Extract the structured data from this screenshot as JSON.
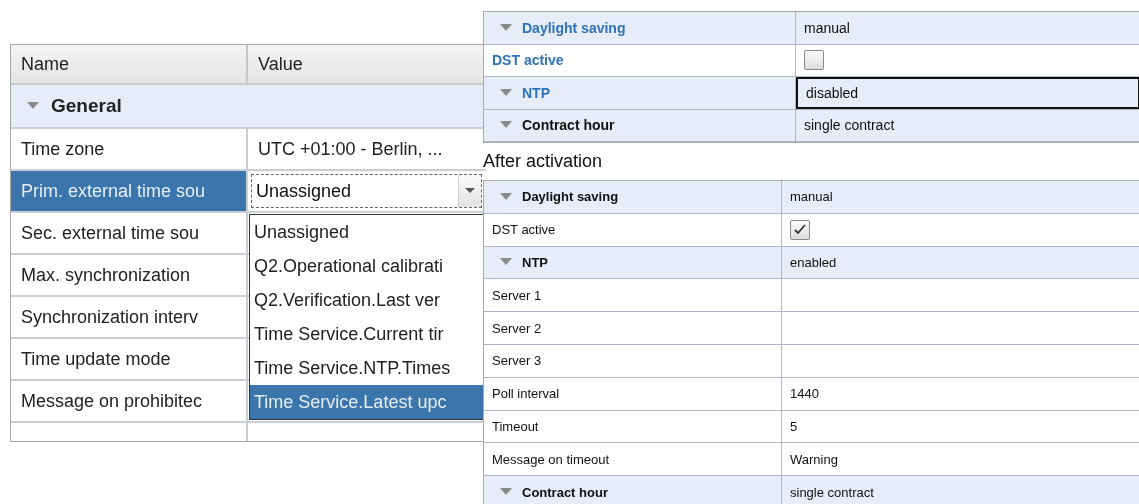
{
  "settings_table": {
    "columns": [
      "Name",
      "Value"
    ],
    "rows": [
      {
        "kind": "group",
        "name": "General",
        "expanded": true
      },
      {
        "kind": "field",
        "name": "Time zone",
        "value": "UTC +01:00 - Berlin, ...",
        "selected": false
      },
      {
        "kind": "combo",
        "name": "Prim. external time sou",
        "value": "Unassigned",
        "selected": true
      },
      {
        "kind": "field",
        "name": "Sec. external time sou",
        "selected": false
      },
      {
        "kind": "field",
        "name": "Max. synchronization",
        "selected": false
      },
      {
        "kind": "field",
        "name": "Synchronization interv",
        "selected": false
      },
      {
        "kind": "field",
        "name": "Time update mode",
        "selected": false
      },
      {
        "kind": "field",
        "name": "Message on prohibitec",
        "selected": false
      }
    ],
    "dropdown_options": [
      {
        "label": "Unassigned",
        "selected": false
      },
      {
        "label": "Q2.Operational calibrati",
        "selected": false
      },
      {
        "label": "Q2.Verification.Last ver",
        "selected": false
      },
      {
        "label": "Time Service.Current tir",
        "selected": false
      },
      {
        "label": "Time Service.NTP.Times",
        "selected": false
      },
      {
        "label": "Time Service.Latest upc",
        "selected": true
      }
    ]
  },
  "before_table": {
    "rows": [
      {
        "kind": "group",
        "name": "Daylight saving",
        "value": "manual",
        "highlighted": true,
        "expanded": true
      },
      {
        "kind": "checkbox",
        "name": "DST active",
        "checked": false,
        "highlighted": true
      },
      {
        "kind": "group",
        "name": "NTP",
        "value": "disabled",
        "highlighted": true,
        "expanded": true,
        "focused": true
      },
      {
        "kind": "group",
        "name": "Contract hour",
        "value": "single contract",
        "highlighted": false,
        "expanded": true
      }
    ]
  },
  "caption": "After activation",
  "after_table": {
    "rows": [
      {
        "kind": "group",
        "name": "Daylight saving",
        "value": "manual",
        "expanded": true
      },
      {
        "kind": "checkbox",
        "name": "DST active",
        "checked": true
      },
      {
        "kind": "group",
        "name": "NTP",
        "value": "enabled",
        "expanded": true
      },
      {
        "kind": "field",
        "name": "Server 1"
      },
      {
        "kind": "field",
        "name": "Server 2"
      },
      {
        "kind": "field",
        "name": "Server 3"
      },
      {
        "kind": "field",
        "name": "Poll interval",
        "value": "1440"
      },
      {
        "kind": "field",
        "name": "Timeout",
        "value": "5"
      },
      {
        "kind": "field",
        "name": "Message on timeout",
        "value": "Warning"
      },
      {
        "kind": "group",
        "name": "Contract hour",
        "value": "single contract",
        "expanded": true
      }
    ]
  }
}
